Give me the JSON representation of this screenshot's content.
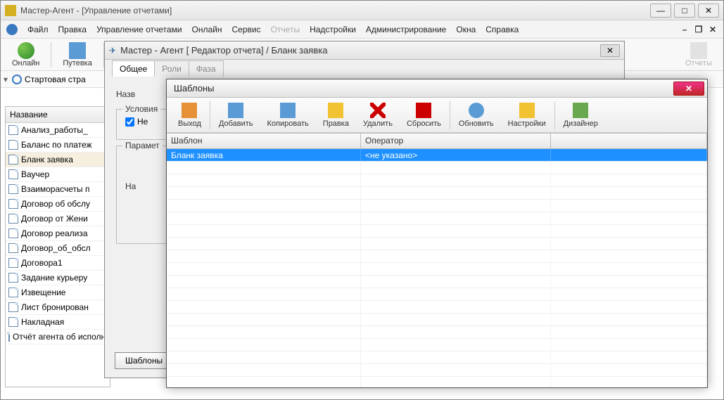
{
  "main": {
    "title": "Мастер-Агент - [Управление отчетами]",
    "menu": [
      "Файл",
      "Правка",
      "Управление отчетами",
      "Онлайн",
      "Сервис",
      "Отчеты",
      "Надстройки",
      "Администрирование",
      "Окна",
      "Справка"
    ],
    "toolbar": {
      "online": "Онлайн",
      "voucher": "Путевка",
      "reports": "Отчеты"
    },
    "start_tab": "Стартовая стра"
  },
  "reports_list": {
    "header": "Название",
    "items": [
      "Анализ_работы_",
      "Баланс по платеж",
      "Бланк заявка",
      "Ваучер",
      "Взаиморасчеты п",
      "Договор об обслу",
      "Договор от Жени",
      "Договор реализа",
      "Договор_об_обсл",
      "Договора1",
      "Задание курьеру",
      "Извещение",
      "Лист бронирован",
      "Накладная",
      "Отчёт агента об исполнении по"
    ],
    "selected_index": 2
  },
  "editor": {
    "title": "Мастер - Агент [ Редактор отчета] / Бланк заявка",
    "tabs": [
      "Общее",
      "Роли",
      "Фаза"
    ],
    "name_label": "Назв",
    "conditions_legend": "Условия",
    "checkbox_label": "Не",
    "params_legend": "Парамет",
    "inner_label": "На",
    "templates_btn": "Шаблоны"
  },
  "dialog": {
    "title": "Шаблоны",
    "toolbar": {
      "exit": "Выход",
      "add": "Добавить",
      "copy": "Копировать",
      "edit": "Правка",
      "delete": "Удалить",
      "reset": "Сбросить",
      "refresh": "Обновить",
      "settings": "Настройки",
      "designer": "Дизайнер"
    },
    "grid": {
      "col_template": "Шаблон",
      "col_operator": "Оператор",
      "rows": [
        {
          "template": "Бланк заявка",
          "operator": "<не указано>"
        }
      ]
    }
  }
}
